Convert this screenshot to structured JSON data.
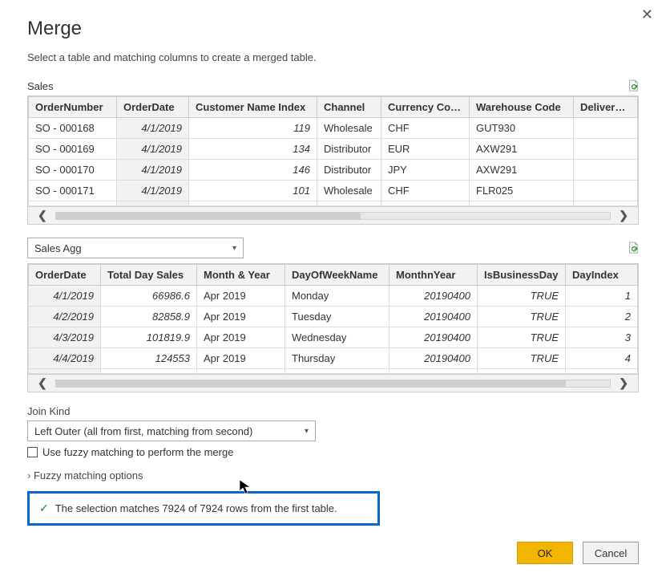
{
  "dialog": {
    "title": "Merge",
    "subtitle": "Select a table and matching columns to create a merged table."
  },
  "table1": {
    "label": "Sales",
    "headers": [
      "OrderNumber",
      "OrderDate",
      "Customer Name Index",
      "Channel",
      "Currency Code",
      "Warehouse Code",
      "Delivery R"
    ],
    "rows": [
      [
        "SO - 000168",
        "4/1/2019",
        "119",
        "Wholesale",
        "CHF",
        "GUT930",
        ""
      ],
      [
        "SO - 000169",
        "4/1/2019",
        "134",
        "Distributor",
        "EUR",
        "AXW291",
        ""
      ],
      [
        "SO - 000170",
        "4/1/2019",
        "146",
        "Distributor",
        "JPY",
        "AXW291",
        ""
      ],
      [
        "SO - 000171",
        "4/1/2019",
        "101",
        "Wholesale",
        "CHF",
        "FLR025",
        ""
      ]
    ]
  },
  "secondTableSelect": {
    "value": "Sales Agg"
  },
  "table2": {
    "headers": [
      "OrderDate",
      "Total Day Sales",
      "Month & Year",
      "DayOfWeekName",
      "MonthnYear",
      "IsBusinessDay",
      "DayIndex"
    ],
    "rows": [
      [
        "4/1/2019",
        "66986.6",
        "Apr 2019",
        "Monday",
        "20190400",
        "TRUE",
        "1"
      ],
      [
        "4/2/2019",
        "82858.9",
        "Apr 2019",
        "Tuesday",
        "20190400",
        "TRUE",
        "2"
      ],
      [
        "4/3/2019",
        "101819.9",
        "Apr 2019",
        "Wednesday",
        "20190400",
        "TRUE",
        "3"
      ],
      [
        "4/4/2019",
        "124553",
        "Apr 2019",
        "Thursday",
        "20190400",
        "TRUE",
        "4"
      ]
    ]
  },
  "joinKind": {
    "label": "Join Kind",
    "value": "Left Outer (all from first, matching from second)"
  },
  "fuzzy": {
    "checkbox_label": "Use fuzzy matching to perform the merge",
    "expander_label": "Fuzzy matching options"
  },
  "status": {
    "text": "The selection matches 7924 of 7924 rows from the first table."
  },
  "buttons": {
    "ok": "OK",
    "cancel": "Cancel"
  }
}
